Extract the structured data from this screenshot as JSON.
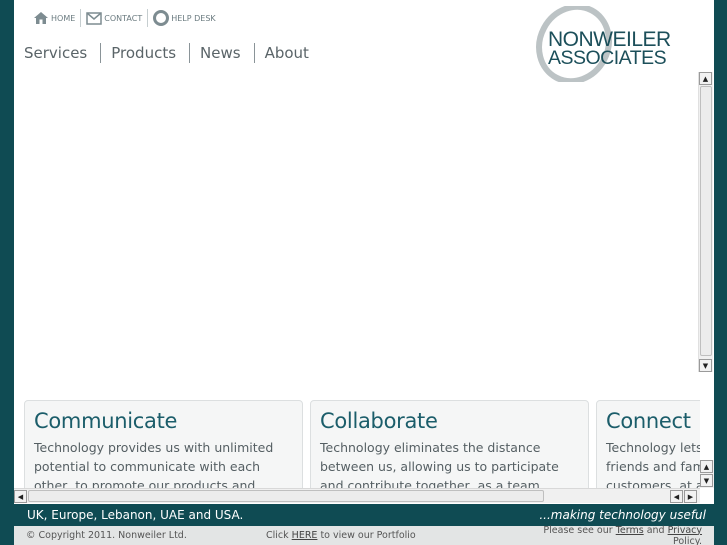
{
  "toplinks": [
    {
      "label": "HOME",
      "icon": "home-icon"
    },
    {
      "label": "CONTACT",
      "icon": "mail-icon"
    },
    {
      "label": "HELP DESK",
      "icon": "lifebuoy-icon"
    }
  ],
  "nav": {
    "items": [
      "Services",
      "Products",
      "News",
      "About"
    ]
  },
  "logo": {
    "line1": "NONWEILER",
    "line2": "ASSOCIATES"
  },
  "cards": [
    {
      "title": "Communicate",
      "text": "Technology provides us with unlimited potential to communicate with each other, to promote our products and services and"
    },
    {
      "title": "Collaborate",
      "text": "Technology eliminates the distance between us, allowing us to participate and contribute together, as a team, regardless of where we"
    },
    {
      "title": "Connect",
      "text": "Technology lets us stay in touch with friends and family, our colleagues, customers, at any"
    }
  ],
  "footer": {
    "locations": "UK, Europe, Lebanon, UAE and USA.",
    "tagline": "...making technology useful",
    "copyright": "© Copyright 2011. Nonweiler Ltd.",
    "portfolio_pre": "Click ",
    "portfolio_link": "HERE",
    "portfolio_post": " to view our Portfolio",
    "policy_pre": "Please see our ",
    "terms_link": "Terms",
    "policy_and": " and ",
    "privacy_link": "Privacy",
    "policy_post": " Policy."
  },
  "colors": {
    "background": "#0f4b53",
    "heading": "#1b5d6a",
    "text": "#555f63"
  }
}
